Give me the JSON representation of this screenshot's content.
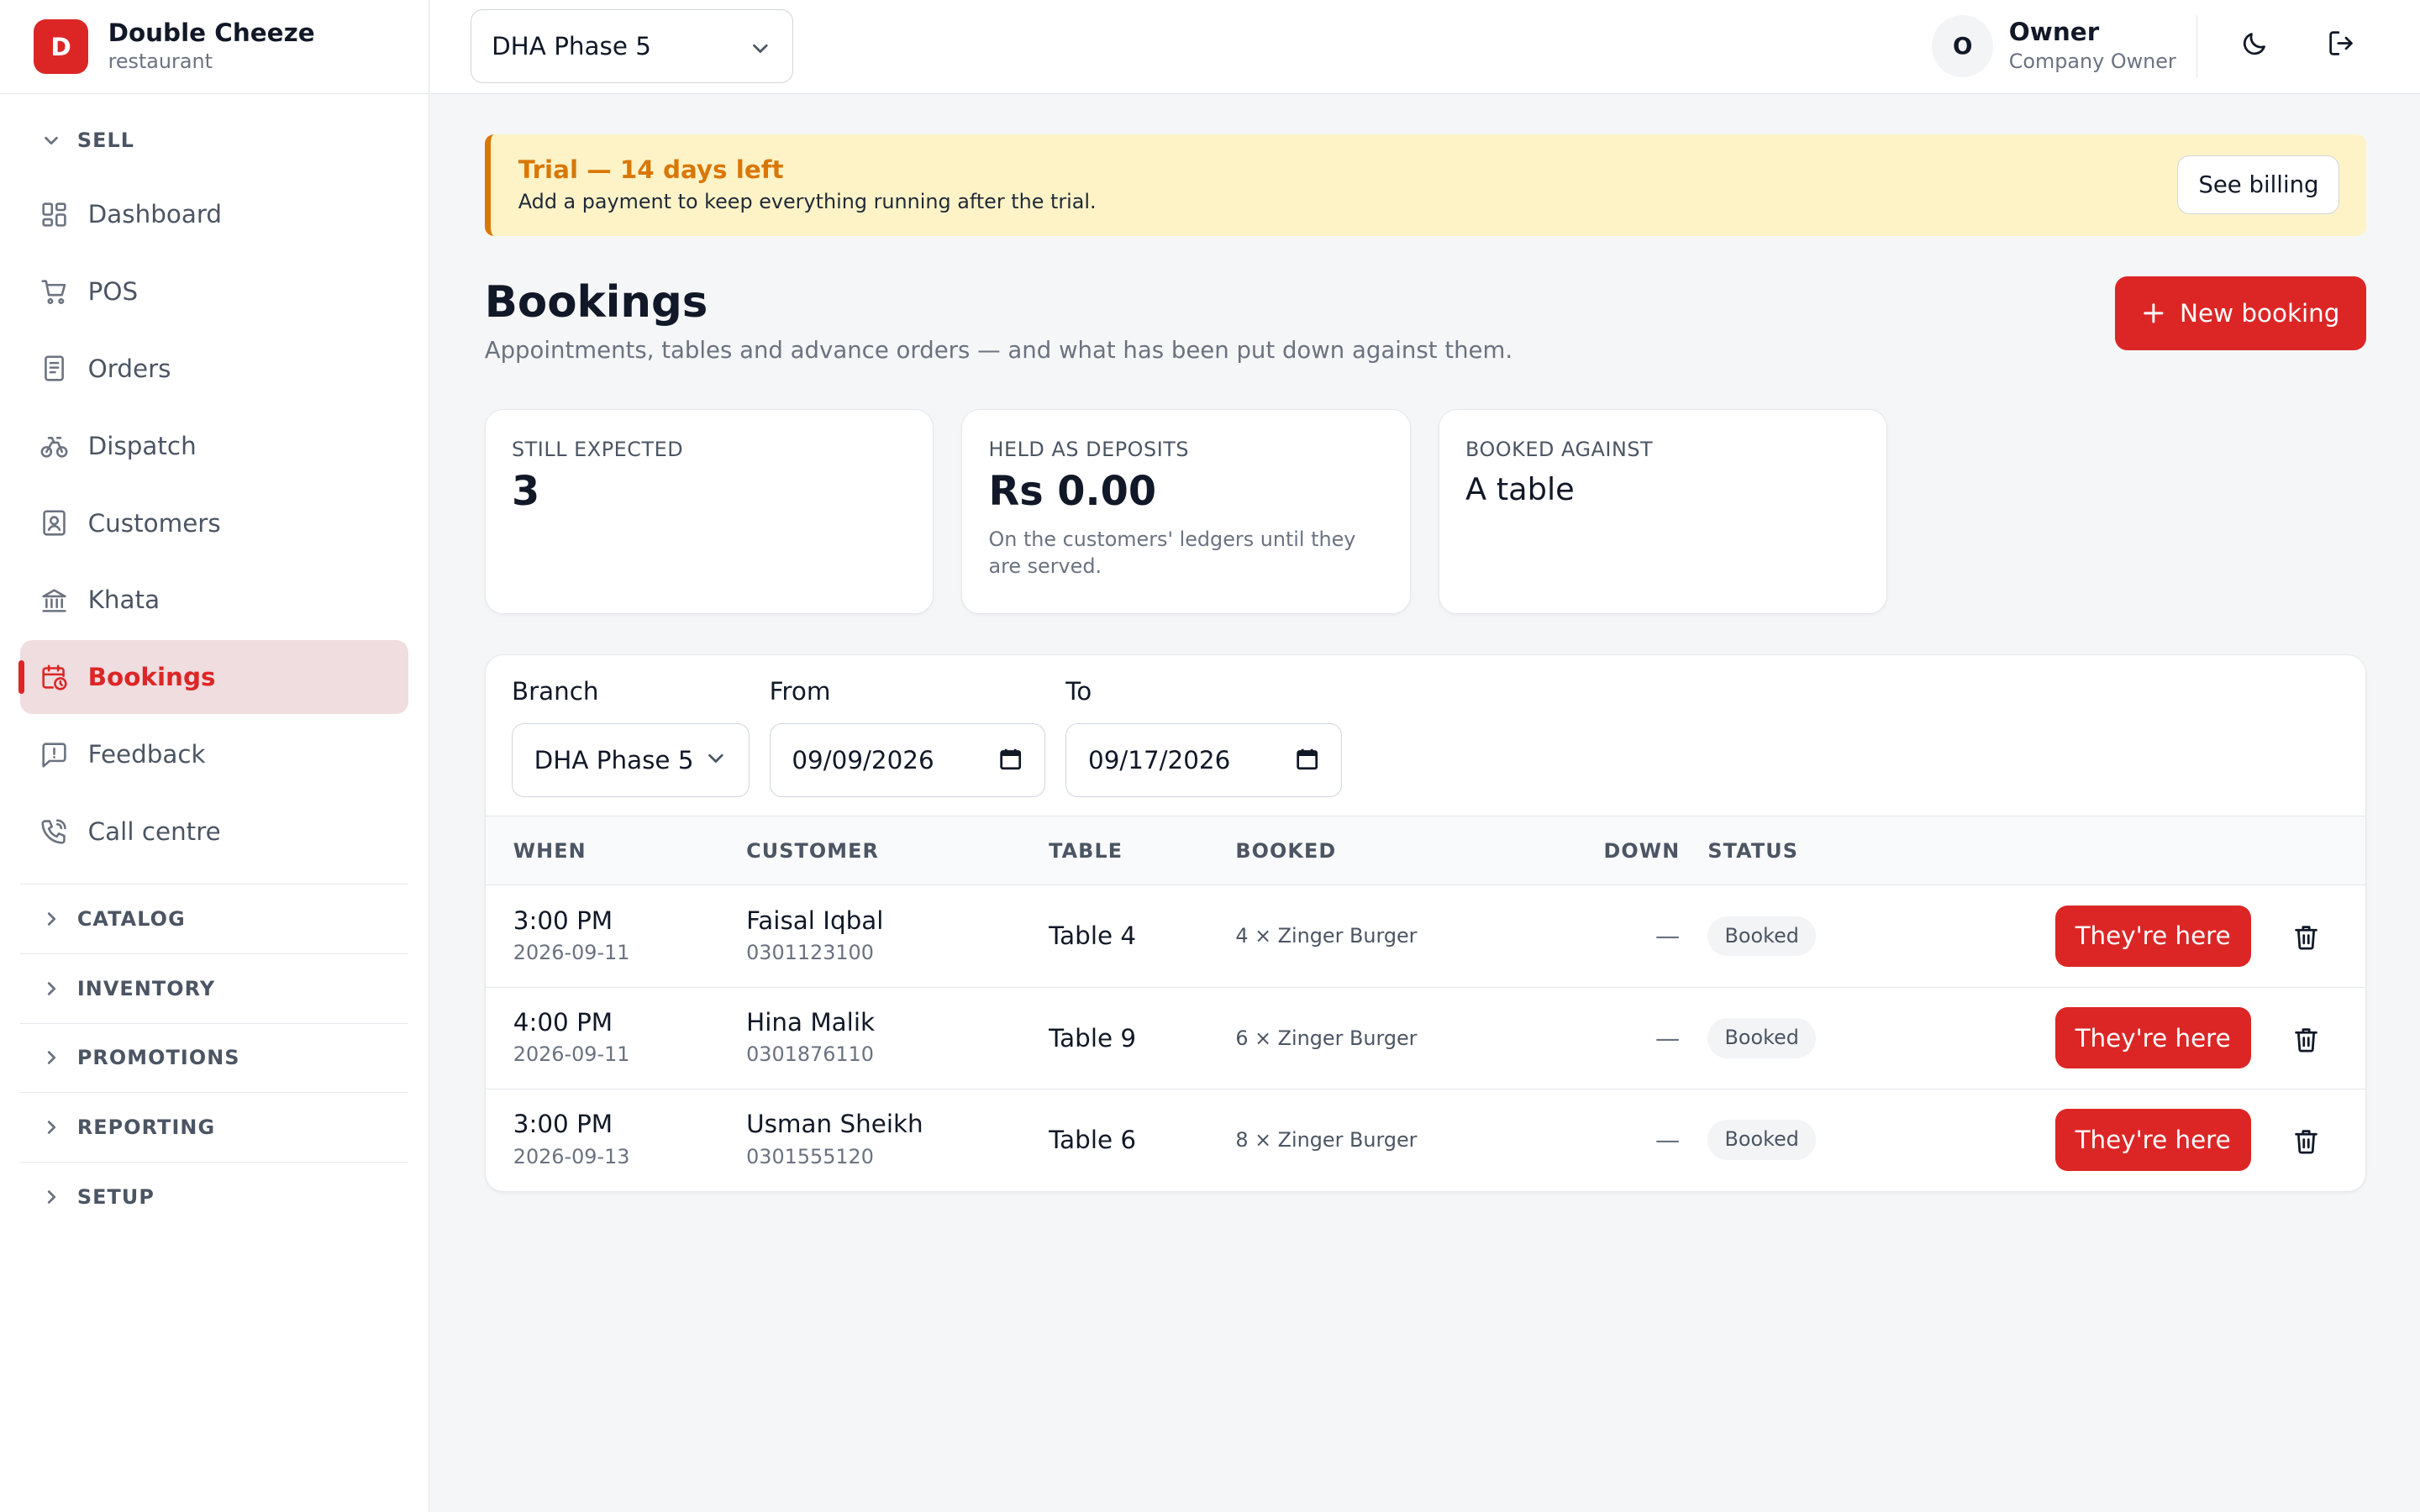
{
  "brand": {
    "initial": "D",
    "name": "Double Cheeze",
    "subtitle": "restaurant"
  },
  "topbar": {
    "branch": "DHA Phase 5",
    "user_initial": "O",
    "user_name": "Owner",
    "user_role": "Company Owner",
    "icons": [
      "moon-icon",
      "logout-icon"
    ]
  },
  "sidebar": {
    "sell_label": "SELL",
    "items": [
      {
        "label": "Dashboard",
        "icon": "dashboard-icon"
      },
      {
        "label": "POS",
        "icon": "cart-icon"
      },
      {
        "label": "Orders",
        "icon": "receipt-icon"
      },
      {
        "label": "Dispatch",
        "icon": "bike-icon"
      },
      {
        "label": "Customers",
        "icon": "contact-icon"
      },
      {
        "label": "Khata",
        "icon": "bank-icon"
      },
      {
        "label": "Bookings",
        "icon": "calendar-clock-icon",
        "active": true
      },
      {
        "label": "Feedback",
        "icon": "message-alert-icon"
      },
      {
        "label": "Call centre",
        "icon": "phone-icon"
      }
    ],
    "sections": [
      "CATALOG",
      "INVENTORY",
      "PROMOTIONS",
      "REPORTING",
      "SETUP"
    ]
  },
  "trial": {
    "title": "Trial — 14 days left",
    "text": "Add a payment to keep everything running after the trial.",
    "button": "See billing"
  },
  "page": {
    "title": "Bookings",
    "subtitle": "Appointments, tables and advance orders — and what has been put down against them.",
    "new_button": "New booking"
  },
  "stats": [
    {
      "label": "STILL EXPECTED",
      "value": "3",
      "note": ""
    },
    {
      "label": "HELD AS DEPOSITS",
      "value": "Rs 0.00",
      "note": "On the customers' ledgers until they are served."
    },
    {
      "label": "BOOKED AGAINST",
      "value": "A table",
      "note": ""
    }
  ],
  "filters": {
    "branch_label": "Branch",
    "branch_value": "DHA Phase 5",
    "from_label": "From",
    "from_value": "09/09/2026",
    "to_label": "To",
    "to_value": "09/17/2026"
  },
  "table": {
    "columns": [
      "WHEN",
      "CUSTOMER",
      "TABLE",
      "BOOKED",
      "DOWN",
      "STATUS"
    ],
    "action_label": "They're here",
    "rows": [
      {
        "time": "3:00 PM",
        "date": "2026-09-11",
        "customer": "Faisal Iqbal",
        "phone": "0301123100",
        "table": "Table 4",
        "booked": "4 × Zinger Burger",
        "down": "—",
        "status": "Booked"
      },
      {
        "time": "4:00 PM",
        "date": "2026-09-11",
        "customer": "Hina Malik",
        "phone": "0301876110",
        "table": "Table 9",
        "booked": "6 × Zinger Burger",
        "down": "—",
        "status": "Booked"
      },
      {
        "time": "3:00 PM",
        "date": "2026-09-13",
        "customer": "Usman Sheikh",
        "phone": "0301555120",
        "table": "Table 6",
        "booked": "8 × Zinger Burger",
        "down": "—",
        "status": "Booked"
      }
    ]
  },
  "colors": {
    "accent": "#dc2626",
    "trial_bg": "#fef3c7",
    "trial_accent": "#d97706",
    "active_bg": "#f0dde0"
  }
}
